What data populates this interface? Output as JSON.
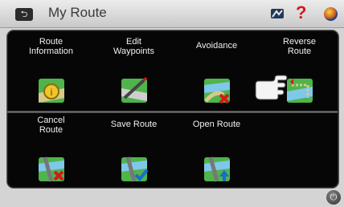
{
  "header": {
    "title": "My Route",
    "back_icon": "back-icon",
    "help_icon": "?",
    "map_icon": "map-icon",
    "globe_icon": "globe-icon"
  },
  "menu": {
    "row1": [
      {
        "label_1": "Route",
        "label_2": "Information",
        "icon": "info-map-icon"
      },
      {
        "label_1": "Edit",
        "label_2": "Waypoints",
        "icon": "edit-waypoints-icon"
      },
      {
        "label_1": "Avoidance",
        "label_2": "",
        "icon": "avoidance-icon"
      },
      {
        "label_1": "Reverse",
        "label_2": "Route",
        "icon": "reverse-route-icon"
      }
    ],
    "row2": [
      {
        "label_1": "Cancel",
        "label_2": "Route",
        "icon": "cancel-route-icon"
      },
      {
        "label_1": "Save Route",
        "label_2": "",
        "icon": "save-route-icon"
      },
      {
        "label_1": "Open Route",
        "label_2": "",
        "icon": "open-route-icon"
      }
    ]
  },
  "footer": {
    "power_icon": "power-icon"
  },
  "colors": {
    "panel": "#060606",
    "title": "#3a3a3a",
    "help": "#d11a1a"
  }
}
